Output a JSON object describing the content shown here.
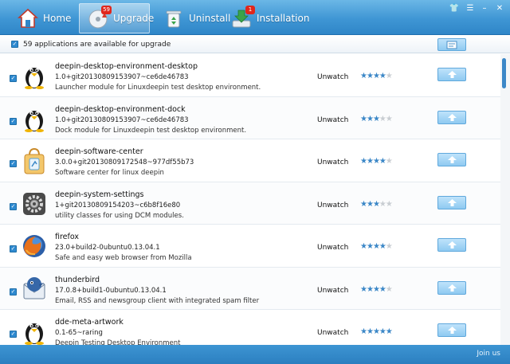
{
  "nav": {
    "home": {
      "label": "Home"
    },
    "upgrade": {
      "label": "Upgrade",
      "badge": "59"
    },
    "uninstall": {
      "label": "Uninstall"
    },
    "installation": {
      "label": "Installation",
      "badge": "1"
    }
  },
  "toolbar": {
    "available_text": "59 applications are available for upgrade"
  },
  "apps": [
    {
      "name": "deepin-desktop-environment-desktop",
      "version": "1.0+git20130809153907~ce6de46783",
      "description": "Launcher module for  Linuxdeepin test desktop environment.",
      "watch": "Unwatch",
      "rating": 4,
      "icon": "tux-icon"
    },
    {
      "name": "deepin-desktop-environment-dock",
      "version": "1.0+git20130809153907~ce6de46783",
      "description": "Dock module for Linuxdeepin test desktop environment.",
      "watch": "Unwatch",
      "rating": 2.5,
      "icon": "tux-icon"
    },
    {
      "name": "deepin-software-center",
      "version": "3.0.0+git20130809172548~977df55b73",
      "description": "Software center for linux deepin",
      "watch": "Unwatch",
      "rating": 4,
      "icon": "shopping-bag-icon"
    },
    {
      "name": "deepin-system-settings",
      "version": "1+git20130809154203~c6b8f16e80",
      "description": "utility classes for using DCM modules.",
      "watch": "Unwatch",
      "rating": 3,
      "icon": "settings-gear-icon"
    },
    {
      "name": "firefox",
      "version": "23.0+build2-0ubuntu0.13.04.1",
      "description": "Safe and easy web browser from Mozilla",
      "watch": "Unwatch",
      "rating": 3.5,
      "icon": "firefox-icon"
    },
    {
      "name": "thunderbird",
      "version": "17.0.8+build1-0ubuntu0.13.04.1",
      "description": "Email, RSS and newsgroup client with integrated spam filter",
      "watch": "Unwatch",
      "rating": 4,
      "icon": "thunderbird-icon"
    },
    {
      "name": "dde-meta-artwork",
      "version": "0.1-65~raring",
      "description": "Deepin Testing Desktop Environment",
      "watch": "Unwatch",
      "rating": 5,
      "icon": "tux-icon"
    }
  ],
  "footer": {
    "join_label": "Join us"
  },
  "colors": {
    "header_blue": "#3f96d4",
    "accent_blue": "#3b87c7",
    "badge_red": "#e0261c",
    "button_blue": "#8fcaf1"
  }
}
